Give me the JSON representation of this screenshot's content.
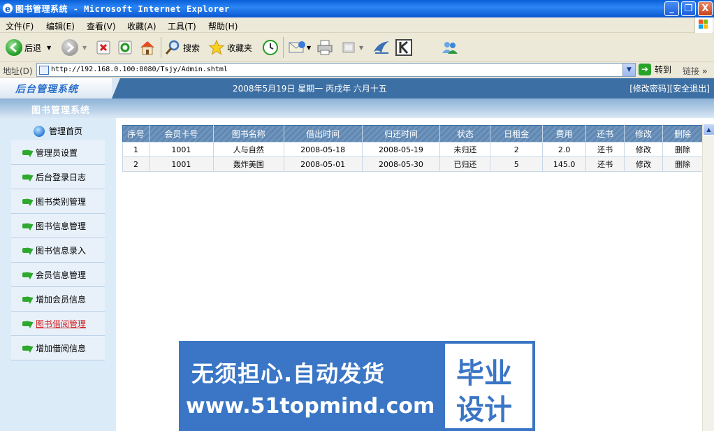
{
  "window": {
    "title": "图书管理系统 - Microsoft Internet Explorer",
    "min_label": "_",
    "restore_label": "❐",
    "close_label": "X"
  },
  "menubar": {
    "items": [
      "文件(F)",
      "编辑(E)",
      "查看(V)",
      "收藏(A)",
      "工具(T)",
      "帮助(H)"
    ]
  },
  "toolbar": {
    "back": "后退",
    "search": "搜索",
    "favorites": "收藏夹"
  },
  "addressbar": {
    "label": "地址(D)",
    "url": "http://192.168.0.100:8080/Tsjy/Admin.shtml",
    "go": "转到",
    "links": "链接"
  },
  "header": {
    "logo": "后台管理系统",
    "date": "2008年5月19日 星期一 丙戌年 六月十五",
    "change_password": "[修改密码]",
    "logout": "[安全退出]"
  },
  "subheader": {
    "title": "图书管理系统"
  },
  "sidebar": {
    "home": "管理首页",
    "items": [
      {
        "label": "管理员设置"
      },
      {
        "label": "后台登录日志"
      },
      {
        "label": "图书类别管理"
      },
      {
        "label": "图书信息管理"
      },
      {
        "label": "图书信息录入"
      },
      {
        "label": "会员信息管理"
      },
      {
        "label": "增加会员信息"
      },
      {
        "label": "图书借阅管理",
        "active": true
      },
      {
        "label": "增加借阅信息"
      }
    ]
  },
  "table": {
    "headers": [
      "序号",
      "会员卡号",
      "图书名称",
      "借出时间",
      "归还时间",
      "状态",
      "日租金",
      "费用",
      "还书",
      "修改",
      "删除"
    ],
    "rows": [
      [
        "1",
        "1001",
        "人与自然",
        "2008-05-18",
        "2008-05-19",
        "未归还",
        "2",
        "2.0",
        "还书",
        "修改",
        "删除"
      ],
      [
        "2",
        "1001",
        "轰炸美国",
        "2008-05-01",
        "2008-05-30",
        "已归还",
        "5",
        "145.0",
        "还书",
        "修改",
        "删除"
      ]
    ]
  },
  "watermark": {
    "line1": "无须担心.自动发货",
    "line2": "www.51topmind.com",
    "box_line1": "毕业",
    "box_line2": "设计"
  },
  "colors": {
    "title_bar": "#0a5fd8",
    "header_bg": "#3c6fa3",
    "sidebar_bg": "#dcebf8",
    "active_link": "#d42020",
    "watermark_bg": "#3a76c5"
  }
}
